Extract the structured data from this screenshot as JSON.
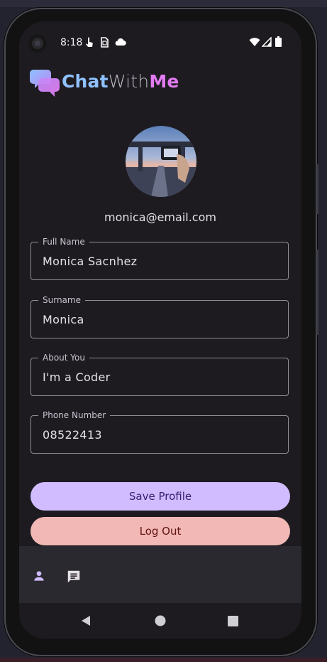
{
  "status_bar": {
    "time": "8:18",
    "icons": [
      "touch-icon",
      "sim-icon",
      "cloud-icon",
      "wifi-icon",
      "signal-icon",
      "battery-icon"
    ]
  },
  "app": {
    "logo_part1": "Chat",
    "logo_part2": "With",
    "logo_part3": "Me",
    "colors": {
      "chat": "#8fc1ff",
      "with": "#b8b8c4",
      "me": "#e37bf2"
    }
  },
  "profile": {
    "email": "monica@email.com",
    "fields": [
      {
        "label": "Full Name",
        "value": "Monica Sacnhez"
      },
      {
        "label": "Surname",
        "value": "Monica"
      },
      {
        "label": "About You",
        "value": "I'm a Coder"
      },
      {
        "label": "Phone Number",
        "value": "08522413"
      }
    ]
  },
  "buttons": {
    "save": "Save Profile",
    "logout": "Log Out"
  },
  "theme": {
    "primary": "#d0bcff",
    "error_container": "#f2b8b5",
    "background": "#1d1b20"
  },
  "bottom_nav": {
    "items": [
      "person-icon",
      "chat-icon"
    ],
    "selected": "person-icon"
  },
  "system_nav": [
    "back-icon",
    "home-icon",
    "recents-icon"
  ]
}
